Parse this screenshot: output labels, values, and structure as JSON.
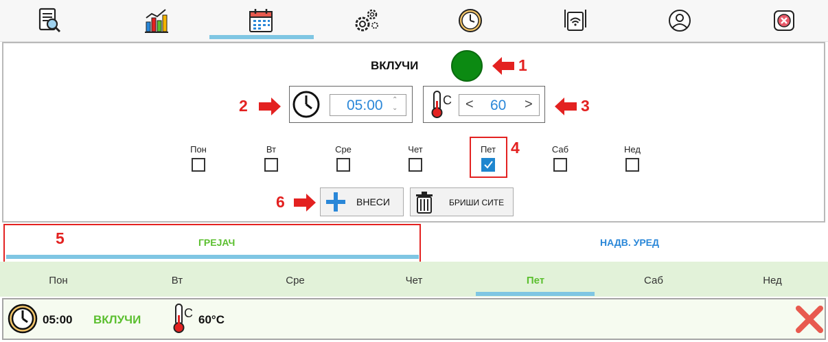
{
  "top_tabs": [
    {
      "icon": "document-search-icon"
    },
    {
      "icon": "bar-chart-icon"
    },
    {
      "icon": "calendar-icon",
      "active": true
    },
    {
      "icon": "gears-icon"
    },
    {
      "icon": "clock-icon"
    },
    {
      "icon": "wifi-router-icon"
    },
    {
      "icon": "user-profile-icon"
    },
    {
      "icon": "close-app-icon"
    }
  ],
  "settings": {
    "status_label": "ВКЛУЧИ",
    "status_color": "#0c8a12",
    "time_value": "05:00",
    "temperature_value": "60",
    "temp_unit_symbol": "C",
    "days": [
      {
        "label": "Пон",
        "checked": false
      },
      {
        "label": "Вт",
        "checked": false
      },
      {
        "label": "Сре",
        "checked": false
      },
      {
        "label": "Чет",
        "checked": false
      },
      {
        "label": "Пет",
        "checked": true
      },
      {
        "label": "Саб",
        "checked": false
      },
      {
        "label": "Нед",
        "checked": false
      }
    ],
    "add_label": "ВНЕСИ",
    "delete_all_label": "БРИШИ СИТЕ"
  },
  "annotations": {
    "n1": "1",
    "n2": "2",
    "n3": "3",
    "n4": "4",
    "n5": "5",
    "n6": "6"
  },
  "mode_tabs": [
    {
      "label": "ГРЕЈАЧ",
      "color": "#5bbf2f",
      "active": true
    },
    {
      "label": "НАДВ. УРЕД",
      "color": "#2a87d8",
      "active": false
    }
  ],
  "day_tabs": [
    {
      "label": "Пон"
    },
    {
      "label": "Вт"
    },
    {
      "label": "Сре"
    },
    {
      "label": "Чет"
    },
    {
      "label": "Пет",
      "active": true
    },
    {
      "label": "Саб"
    },
    {
      "label": "Нед"
    }
  ],
  "entry": {
    "time": "05:00",
    "status": "ВКЛУЧИ",
    "temperature": "60°C",
    "temp_unit_symbol": "C"
  },
  "colors": {
    "accent_blue": "#2a87d8",
    "accent_green": "#5bbf2f",
    "annotation_red": "#e32120",
    "indicator": "#7fc6e3"
  }
}
